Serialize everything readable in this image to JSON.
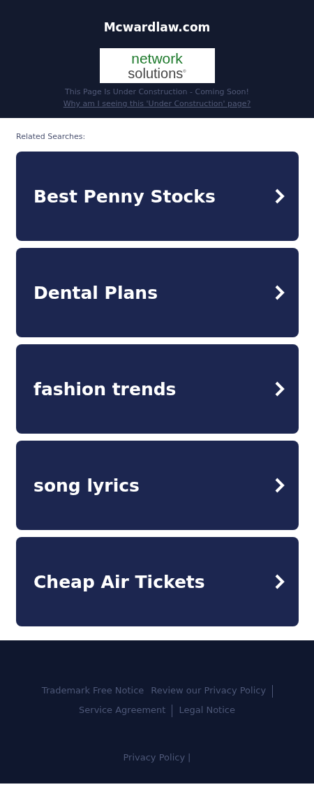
{
  "header": {
    "site_title": "Mcwardlaw.com",
    "logo": {
      "line1": "network",
      "line2": "solutions",
      "mark": "®"
    },
    "notice": "This Page Is Under Construction - Coming Soon!",
    "why_link": "Why am I seeing this 'Under Construction' page?"
  },
  "related": {
    "heading": "Related Searches:",
    "items": [
      {
        "label": "Best Penny Stocks"
      },
      {
        "label": "Dental Plans"
      },
      {
        "label": "fashion trends"
      },
      {
        "label": "song lyrics"
      },
      {
        "label": "Cheap Air Tickets"
      }
    ]
  },
  "footer": {
    "links": [
      {
        "label": "Trademark Free Notice",
        "separator_before": false
      },
      {
        "label": "Review our Privacy Policy",
        "separator_before": false
      },
      {
        "label": "Service Agreement",
        "separator_before": true
      },
      {
        "label": "Legal Notice",
        "separator_before": true
      }
    ],
    "bottom_link": "Privacy Policy",
    "bottom_separator": "|"
  }
}
